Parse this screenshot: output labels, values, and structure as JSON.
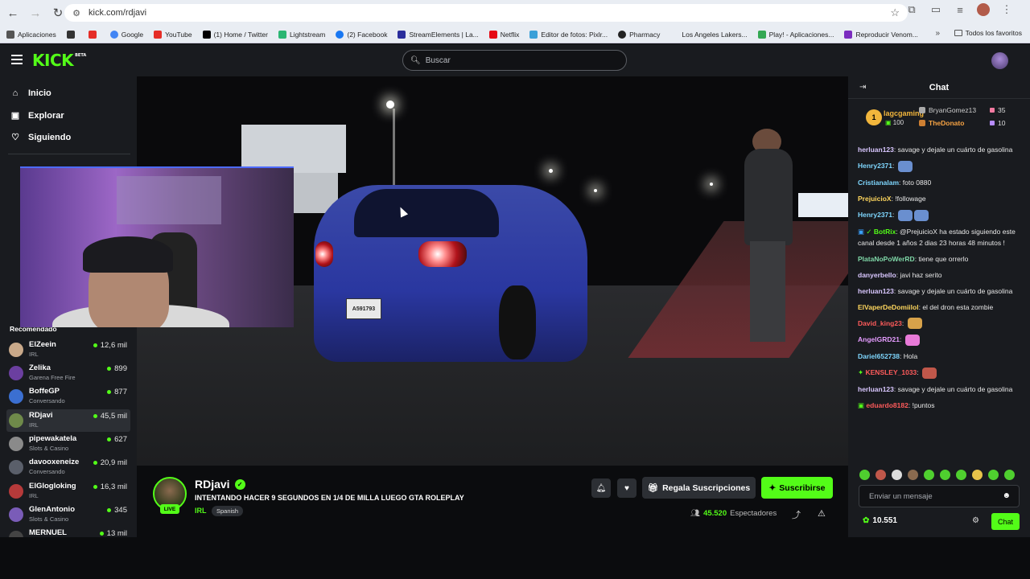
{
  "browser": {
    "url": "kick.com/rdjavi",
    "bookmarks": [
      {
        "label": "Aplicaciones",
        "color": "#4a6cf7"
      },
      {
        "label": "",
        "color": "#333333"
      },
      {
        "label": "",
        "color": "#e52d27"
      },
      {
        "label": "Google",
        "color": "#4285f4"
      },
      {
        "label": "YouTube",
        "color": "#e52d27"
      },
      {
        "label": "(1) Home / Twitter",
        "color": "#000000"
      },
      {
        "label": "Lightstream",
        "color": "#2bb673"
      },
      {
        "label": "(2) Facebook",
        "color": "#1877f2"
      },
      {
        "label": "StreamElements | La...",
        "color": "#2a2d9c"
      },
      {
        "label": "Netflix",
        "color": "#e50914"
      },
      {
        "label": "Editor de fotos: Pixlr...",
        "color": "#3aa0d8"
      },
      {
        "label": "Pharmacy",
        "color": "#222222"
      },
      {
        "label": "Los Angeles Lakers...",
        "color": "#e9edf3"
      },
      {
        "label": "Play! - Aplicaciones...",
        "color": "#34a853"
      },
      {
        "label": "Reproducir Venom...",
        "color": "#7b2cbf"
      }
    ],
    "bookmarks_more": "»",
    "all_bookmarks": "Todos los favoritos"
  },
  "nav": {
    "logo": "KICK",
    "logo_beta": "BETA",
    "search_placeholder": "Buscar"
  },
  "sidebar": {
    "menu": [
      {
        "label": "Inicio",
        "icon": "home-icon"
      },
      {
        "label": "Explorar",
        "icon": "compass-icon"
      },
      {
        "label": "Siguiendo",
        "icon": "heart-icon"
      }
    ],
    "recommended_title": "Recomendado",
    "recommended": [
      {
        "name": "ElZeein",
        "category": "IRL",
        "viewers": "12,6 mil",
        "color": "#c9a98a"
      },
      {
        "name": "Zelika",
        "category": "Garena Free Fire",
        "viewers": "899",
        "color": "#6b3fa0"
      },
      {
        "name": "BoffeGP",
        "category": "Conversando",
        "viewers": "877",
        "color": "#3b6fd1"
      },
      {
        "name": "RDjavi",
        "category": "IRL",
        "viewers": "45,5 mil",
        "color": "#6f8a4a"
      },
      {
        "name": "pipewakatela",
        "category": "Slots & Casino",
        "viewers": "627",
        "color": "#8a8a8a"
      },
      {
        "name": "davooxeneize",
        "category": "Conversando",
        "viewers": "20,9 mil",
        "color": "#5a5f6a"
      },
      {
        "name": "ElGlogloking",
        "category": "IRL",
        "viewers": "16,3 mil",
        "color": "#b63a3a"
      },
      {
        "name": "GlenAntonio",
        "category": "Slots & Casino",
        "viewers": "345",
        "color": "#7a5cb8"
      },
      {
        "name": "MERNUEL",
        "category": "",
        "viewers": "13 mil",
        "color": "#444444"
      }
    ]
  },
  "video": {
    "plate": "A591793"
  },
  "channel": {
    "name": "RDjavi",
    "live": "LIVE",
    "title": "INTENTANDO HACER 9 SEGUNDOS EN 1/4 DE MILLA  LUEGO GTA ROLEPLAY",
    "category": "IRL",
    "tag": "Spanish",
    "gift_label": "Regala Suscripciones",
    "subscribe_label": "Suscribirse",
    "viewers_count": "45.520",
    "viewers_label": "Espectadores"
  },
  "chat": {
    "title": "Chat",
    "leaderboard": {
      "first": {
        "rank": "1",
        "name": "lagcgaming",
        "points": "100"
      },
      "second": {
        "name": "BryanGomez13",
        "value": "35"
      },
      "third": {
        "name": "TheDonato",
        "value": "10"
      }
    },
    "messages": [
      {
        "user": "herluan123",
        "color": "#d9c7ff",
        "text": "savage y dejale un cuárto de gasolina"
      },
      {
        "user": "Henry2371",
        "color": "#7fd7ff",
        "text": ""
      },
      {
        "user": "Cristianalam",
        "color": "#7fd7ff",
        "text": "foto 0880"
      },
      {
        "user": "PrejuicioX",
        "color": "#ffd75e",
        "text": "!followage"
      },
      {
        "user": "Henry2371",
        "color": "#7fd7ff",
        "text": ""
      },
      {
        "user": "BotRix",
        "color": "#53fc18",
        "text": "@PrejuicioX ha estado siguiendo este canal desde 1 años 2 dias 23 horas 48 minutos !"
      },
      {
        "user": "PlataNoPoWerRD",
        "color": "#7fd7a7",
        "text": "tiene que orrerlo"
      },
      {
        "user": "danyerbello",
        "color": "#d9c7ff",
        "text": "javi haz serito"
      },
      {
        "user": "herluan123",
        "color": "#d9c7ff",
        "text": "savage y dejale un cuárto de gasolina"
      },
      {
        "user": "ElVaperDeDomiilol",
        "color": "#ffd75e",
        "text": "el del dron esta zombie"
      },
      {
        "user": "David_king23",
        "color": "#ff5b5b",
        "text": ""
      },
      {
        "user": "AngelGRD21",
        "color": "#e59cff",
        "text": ""
      },
      {
        "user": "Dariel652738",
        "color": "#7fd7ff",
        "text": "Hola"
      },
      {
        "user": "KENSLEY_1033",
        "color": "#ff5b5b",
        "text": ""
      },
      {
        "user": "herluan123",
        "color": "#d9c7ff",
        "text": "savage y dejale un cuárto de gasolina"
      },
      {
        "user": "eduardo8182",
        "color": "#ff5b5b",
        "text": "!puntos"
      }
    ],
    "input_placeholder": "Enviar un mensaje",
    "points": "10.551",
    "chat_button": "Chat"
  }
}
